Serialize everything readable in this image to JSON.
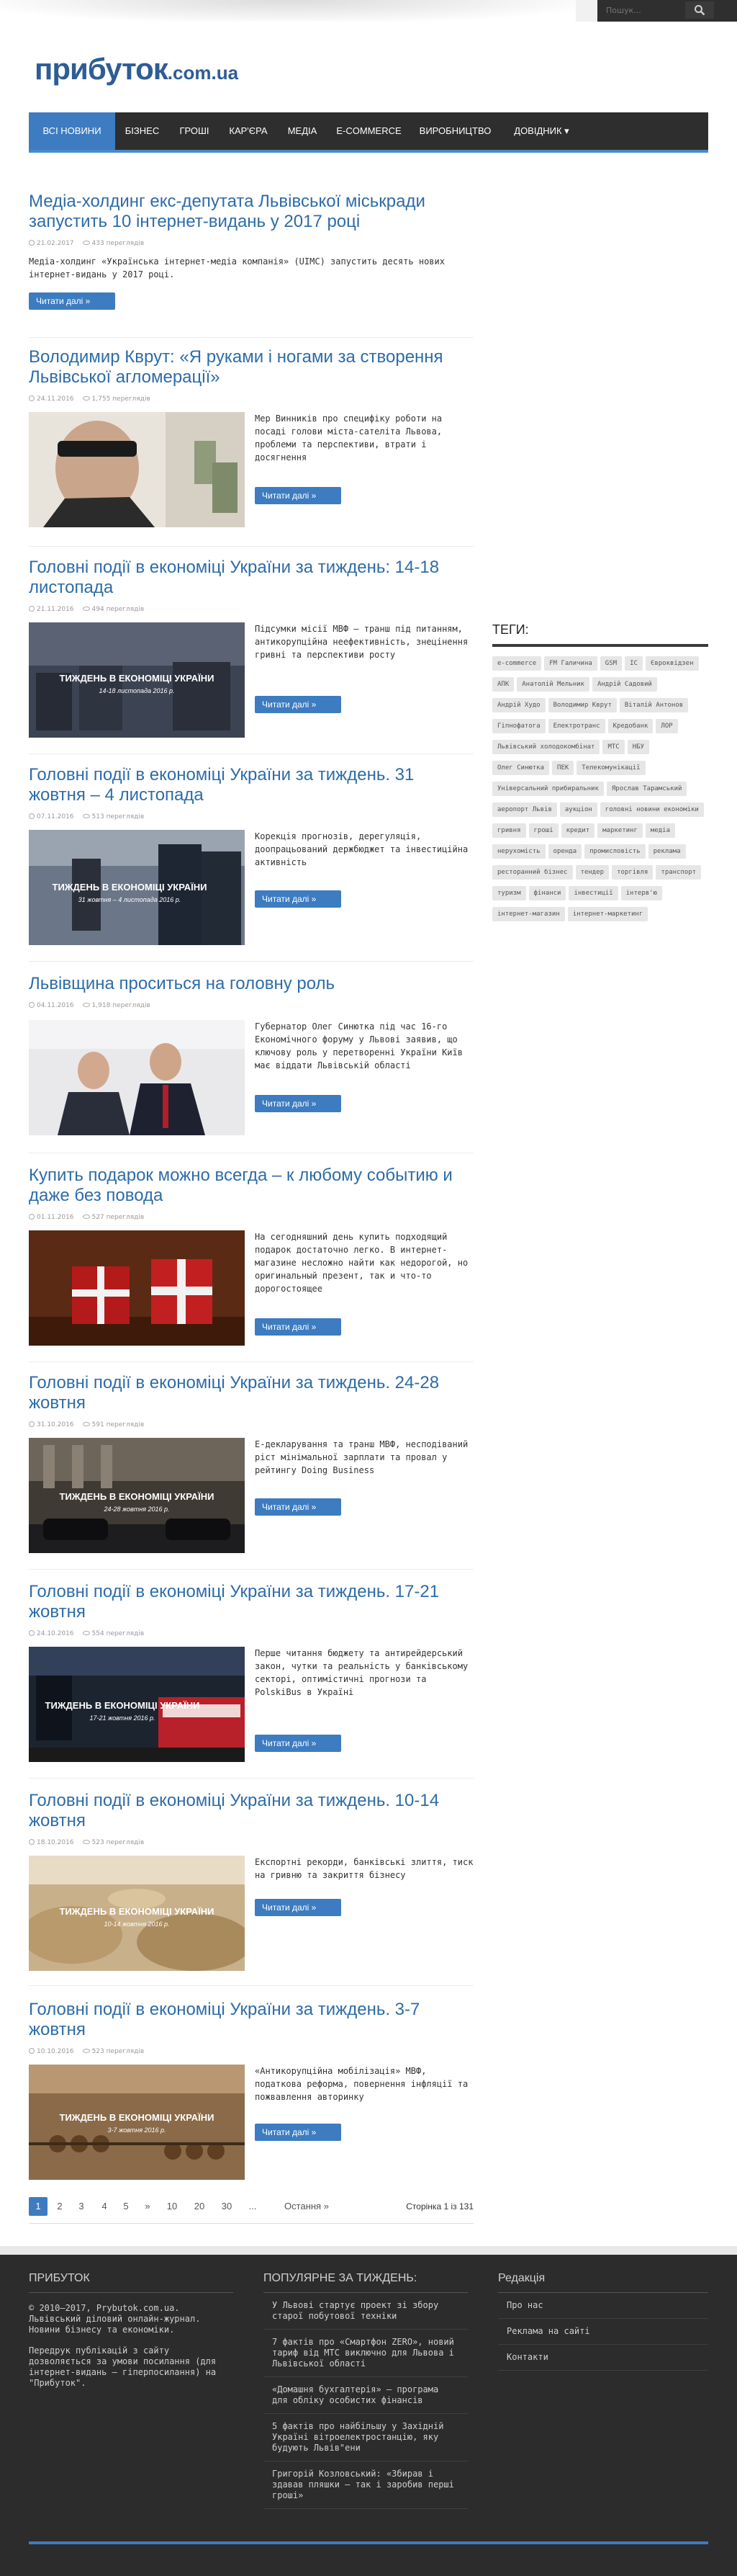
{
  "header": {
    "search_placeholder": "Пошук...",
    "logo_main": "прибуток",
    "logo_domain": ".com.ua"
  },
  "nav": [
    {
      "label": "Всі новини",
      "active": true
    },
    {
      "label": "Бізнес"
    },
    {
      "label": "Гроші"
    },
    {
      "label": "Кар'єра"
    },
    {
      "label": "Медіа"
    },
    {
      "label": "E-Commerce"
    },
    {
      "label": "Виробництво"
    },
    {
      "label": "Довідник ▾"
    }
  ],
  "articles": [
    {
      "title": "Медіа-холдинг екс-депутата Львівської міськради запустить 10 інтернет-видань у 2017 році",
      "date": "21.02.2017",
      "views": "433 переглядів",
      "excerpt": "Медіа-холдинг «Українська інтернет-медіа компанія» (UIMC) запустить десять нових інтернет-видань у 2017 році.",
      "more": "Читати далі »",
      "image": "none"
    },
    {
      "title": "Володимир Кврут: «Я руками і ногами за створення Львівської агломерації»",
      "date": "24.11.2016",
      "views": "1,755 переглядів",
      "excerpt": "Мер Винників про специфіку роботи на посаді голови міста-сателіта Львова, проблеми та перспективи, втрати і досягнення",
      "more": "Читати далі »",
      "image": "portrait"
    },
    {
      "title": "Головні події в економіці України за тиждень: 14-18 листопада",
      "date": "21.11.2016",
      "views": "494 переглядів",
      "excerpt": "Підсумки місії МВФ – транш під питанням, антикорупційна неефективність, знецінення гривні та перспективи росту",
      "more": "Читати далі »",
      "image": "week",
      "caption1": "ТИЖДЕНЬ В ЕКОНОМІЦІ УКРАЇНИ",
      "caption2": "14-18 листопада 2016 р."
    },
    {
      "title": "Головні події в економіці України за тиждень. 31 жовтня – 4 листопада",
      "date": "07.11.2016",
      "views": "513 переглядів",
      "excerpt": "Корекція прогнозів, дерегуляція, доопрацьований держбюджет та інвестиційна активність",
      "more": "Читати далі »",
      "image": "week",
      "caption1": "ТИЖДЕНЬ В ЕКОНОМІЦІ УКРАЇНИ",
      "caption2": "31 жовтня – 4 листопада 2016 р."
    },
    {
      "title": "Львівщина проситься на головну роль",
      "date": "04.11.2016",
      "views": "1,918 переглядів",
      "excerpt": "Губернатор Олег Синютка під час 16-го Економічного форуму у Львові заявив, що ключову роль у перетворенні України Київ має віддати Львівській області",
      "more": "Читати далі »",
      "image": "forum"
    },
    {
      "title": "Купить подарок можно всегда – к любому событию и даже без повода",
      "date": "01.11.2016",
      "views": "527 переглядів",
      "excerpt": "На сегодняшний день купить подходящий подарок достаточно легко. В интернет-магазине несложно найти как недорогой, но оригинальный презент, так и что-то дорогостоящее",
      "more": "Читати далі »",
      "image": "gift"
    },
    {
      "title": "Головні події в економіці України за тиждень. 24-28 жовтня",
      "date": "31.10.2016",
      "views": "591 переглядів",
      "excerpt": "Е-декларування та транш МВФ, несподіваний ріст мінімальної зарплати та провал у рейтингу Doing Business",
      "more": "Читати далі »",
      "image": "week",
      "caption1": "ТИЖДЕНЬ В ЕКОНОМІЦІ УКРАЇНИ",
      "caption2": "24-28 жовтня 2016 р."
    },
    {
      "title": "Головні події в економіці України за тиждень. 17-21 жовтня",
      "date": "24.10.2016",
      "views": "554 переглядів",
      "excerpt": "Перше читання бюджету та антирейдерський закон, чутки та реальність у банківському секторі, оптимістичні прогнози та PolskiBus в Україні",
      "more": "Читати далі »",
      "image": "week",
      "caption1": "ТИЖДЕНЬ В ЕКОНОМІЦІ УКРАЇНИ",
      "caption2": "17-21 жовтня 2016 р."
    },
    {
      "title": "Головні події в економіці України за тиждень. 10-14 жовтня",
      "date": "18.10.2016",
      "views": "523 переглядів",
      "excerpt": "Експортні рекорди, банківські злиття, тиск на гривню та закриття бізнесу",
      "more": "Читати далі »",
      "image": "wheat",
      "caption1": "ТИЖДЕНЬ В ЕКОНОМІЦІ УКРАЇНИ",
      "caption2": "10-14 жовтня 2016 р."
    },
    {
      "title": "Головні події в економіці України за тиждень. 3-7 жовтня",
      "date": "10.10.2016",
      "views": "523 переглядів",
      "excerpt": "«Антикорупційна мобілізація» МВФ, податкова реформа, повернення інфляції та пожвавлення авторинку",
      "more": "Читати далі »",
      "image": "abacus",
      "caption1": "ТИЖДЕНЬ В ЕКОНОМІЦІ УКРАЇНИ",
      "caption2": "3-7 жовтня 2016 р."
    }
  ],
  "sidebar": {
    "tags_title": "ТЕГИ:",
    "tags": [
      "e-commerce",
      "FM Галичина",
      "GSM",
      "IC",
      "Євроквідзен",
      "АПК",
      "Анатолій Мельник",
      "Андрій Садовий",
      "Андрій Худо",
      "Володимир Кврут",
      "Віталій Антонов",
      "Гіпнофатога",
      "Електротранс",
      "Кредобанк",
      "ЛОР",
      "Львівський холодокомбінат",
      "МТС",
      "НБУ",
      "Олег Синютка",
      "ПЕК",
      "Телекомунікації",
      "Універсальний прибиральник",
      "Ярослав Тарамський",
      "аеропорт Львів",
      "аукціон",
      "головні новини економіки",
      "гривня",
      "гроші",
      "кредит",
      "маркетинг",
      "медіа",
      "нерухомість",
      "оренда",
      "промисловість",
      "реклама",
      "ресторанний бізнес",
      "тендер",
      "торгівля",
      "транспорт",
      "туризм",
      "фінанси",
      "інвестиції",
      "інтерв'ю",
      "інтернет-магазин",
      "інтернет-маркетинг"
    ]
  },
  "pagination": {
    "pages": [
      "1",
      "2",
      "3",
      "4",
      "5",
      "»",
      "10",
      "20",
      "30",
      "...",
      "Остання »"
    ],
    "info": "Сторінка 1 із 131"
  },
  "footer": {
    "col1_head": "ПРИБУТОК",
    "col1_text1": "© 2010–2017, Prybutok.com.ua. Львівський діловий онлайн-журнал. Новини бізнесу та економіки.",
    "col1_text2": "Передрук публікацій з сайту дозволяється за умови посилання (для інтернет-видань – гіперпосилання) на \"Прибуток\".",
    "col2_head": "ПОПУЛЯРНЕ ЗА ТИЖДЕНЬ:",
    "col2_items": [
      "У Львові стартує проект зі збору старої побутової техніки",
      "7 фактів про «Смартфон ZERO», новий тариф від МТС виключно для Львова і Львівської області",
      "«Домашня бухгалтерія» – програма для обліку особистих фінансів",
      "5 фактів про найбільшу у Західній Україні вітроелектростанцію, яку будують Львів\"ени",
      "Григорій Козловський: «Збирав і здавав пляшки – так і заробив перші гроші»"
    ],
    "col3_head": "Редакція",
    "col3_items": [
      "Про нас",
      "Реклама на сайті",
      "Контакти"
    ]
  }
}
